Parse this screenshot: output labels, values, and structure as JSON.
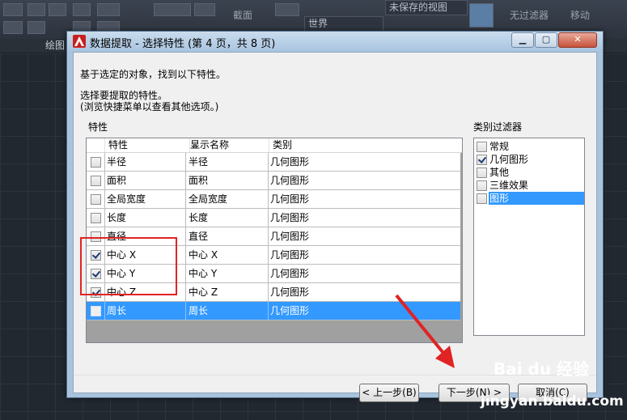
{
  "ribbon": {
    "panel_label": "绘图",
    "section_label": "截面",
    "viewport_label": "世界",
    "view_select": "未保存的视图",
    "filter_label": "无过滤器",
    "move_label": "移动"
  },
  "dialog": {
    "title": "数据提取 - 选择特性 (第 4 页，共 8 页)",
    "intro": "基于选定的对象，找到以下特性。",
    "instruction": "选择要提取的特性。",
    "hint": "(浏览快捷菜单以查看其他选项。)",
    "properties_group": "特性",
    "filter_group": "类别过滤器",
    "columns": [
      "特性",
      "显示名称",
      "类别"
    ],
    "rows": [
      {
        "property": "半径",
        "display": "半径",
        "category": "几何图形",
        "checked": false,
        "selected": false
      },
      {
        "property": "面积",
        "display": "面积",
        "category": "几何图形",
        "checked": false,
        "selected": false
      },
      {
        "property": "全局宽度",
        "display": "全局宽度",
        "category": "几何图形",
        "checked": false,
        "selected": false
      },
      {
        "property": "长度",
        "display": "长度",
        "category": "几何图形",
        "checked": false,
        "selected": false
      },
      {
        "property": "直径",
        "display": "直径",
        "category": "几何图形",
        "checked": false,
        "selected": false
      },
      {
        "property": "中心 X",
        "display": "中心 X",
        "category": "几何图形",
        "checked": true,
        "selected": false
      },
      {
        "property": "中心 Y",
        "display": "中心 Y",
        "category": "几何图形",
        "checked": true,
        "selected": false
      },
      {
        "property": "中心 Z",
        "display": "中心 Z",
        "category": "几何图形",
        "checked": true,
        "selected": false
      },
      {
        "property": "周长",
        "display": "周长",
        "category": "几何图形",
        "checked": false,
        "selected": true
      }
    ],
    "filters": [
      {
        "label": "常规",
        "checked": false,
        "selected": false
      },
      {
        "label": "几何图形",
        "checked": true,
        "selected": false
      },
      {
        "label": "其他",
        "checked": false,
        "selected": false
      },
      {
        "label": "三维效果",
        "checked": false,
        "selected": false
      },
      {
        "label": "图形",
        "checked": false,
        "selected": true
      }
    ],
    "buttons": {
      "back": "< 上一步(B)",
      "next": "下一步(N) >",
      "cancel": "取消(C)"
    }
  },
  "watermark": {
    "brand": "Bai du 经验",
    "url": "jingyan.baidu.com"
  },
  "colors": {
    "selection": "#3399ff",
    "annotation": "#e02323"
  }
}
